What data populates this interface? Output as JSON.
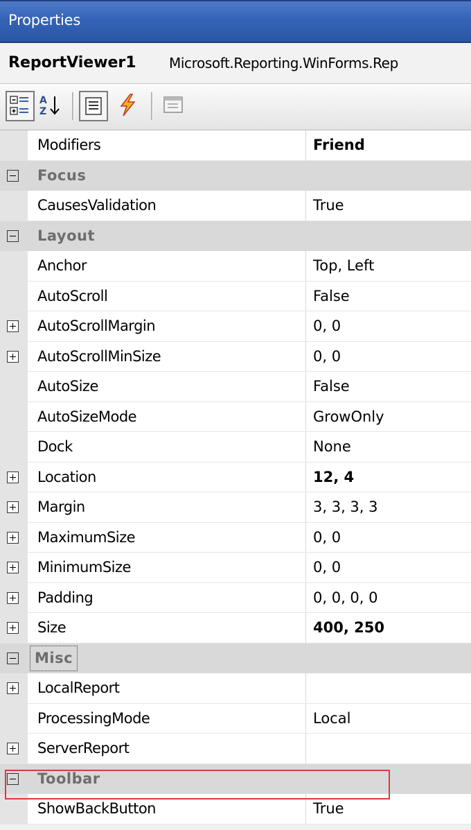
{
  "window": {
    "title": "Properties"
  },
  "object_selector": {
    "name": "ReportViewer1",
    "type": "Microsoft.Reporting.WinForms.Rep"
  },
  "toolbar": {
    "buttons": [
      {
        "icon": "categorized-icon",
        "pressed": true
      },
      {
        "icon": "alphabetical-sort-icon",
        "pressed": false
      },
      {
        "icon": "properties-icon",
        "pressed": true
      },
      {
        "icon": "events-lightning-icon",
        "pressed": false
      },
      {
        "icon": "property-pages-icon",
        "pressed": false
      }
    ]
  },
  "rows": [
    {
      "kind": "prop",
      "name": "Modifiers",
      "value": "Friend",
      "bold": true
    },
    {
      "kind": "cat",
      "name": "Focus",
      "expander": "minus"
    },
    {
      "kind": "prop",
      "name": "CausesValidation",
      "value": "True"
    },
    {
      "kind": "cat",
      "name": "Layout",
      "expander": "minus"
    },
    {
      "kind": "prop",
      "name": "Anchor",
      "value": "Top, Left"
    },
    {
      "kind": "prop",
      "name": "AutoScroll",
      "value": "False"
    },
    {
      "kind": "prop",
      "name": "AutoScrollMargin",
      "value": "0, 0",
      "expander": "plus"
    },
    {
      "kind": "prop",
      "name": "AutoScrollMinSize",
      "value": "0, 0",
      "expander": "plus"
    },
    {
      "kind": "prop",
      "name": "AutoSize",
      "value": "False"
    },
    {
      "kind": "prop",
      "name": "AutoSizeMode",
      "value": "GrowOnly"
    },
    {
      "kind": "prop",
      "name": "Dock",
      "value": "None"
    },
    {
      "kind": "prop",
      "name": "Location",
      "value": "12, 4",
      "bold": true,
      "expander": "plus"
    },
    {
      "kind": "prop",
      "name": "Margin",
      "value": "3, 3, 3, 3",
      "expander": "plus"
    },
    {
      "kind": "prop",
      "name": "MaximumSize",
      "value": "0, 0",
      "expander": "plus"
    },
    {
      "kind": "prop",
      "name": "MinimumSize",
      "value": "0, 0",
      "expander": "plus"
    },
    {
      "kind": "prop",
      "name": "Padding",
      "value": "0, 0, 0, 0",
      "expander": "plus"
    },
    {
      "kind": "prop",
      "name": "Size",
      "value": "400, 250",
      "bold": true,
      "expander": "plus"
    },
    {
      "kind": "cat",
      "name": "Misc",
      "expander": "minus",
      "focused": true
    },
    {
      "kind": "prop",
      "name": "LocalReport",
      "value": "",
      "expander": "plus"
    },
    {
      "kind": "prop",
      "name": "ProcessingMode",
      "value": "Local"
    },
    {
      "kind": "prop",
      "name": "ServerReport",
      "value": "",
      "expander": "plus"
    },
    {
      "kind": "cat",
      "name": "Toolbar",
      "expander": "minus",
      "highlighted": true
    },
    {
      "kind": "prop",
      "name": "ShowBackButton",
      "value": "True"
    }
  ],
  "colors": {
    "title_bar": "#3563b6",
    "category_bg": "#d9d9d9",
    "category_text": "#6d6d6d",
    "highlight_border": "#d93b3b"
  }
}
